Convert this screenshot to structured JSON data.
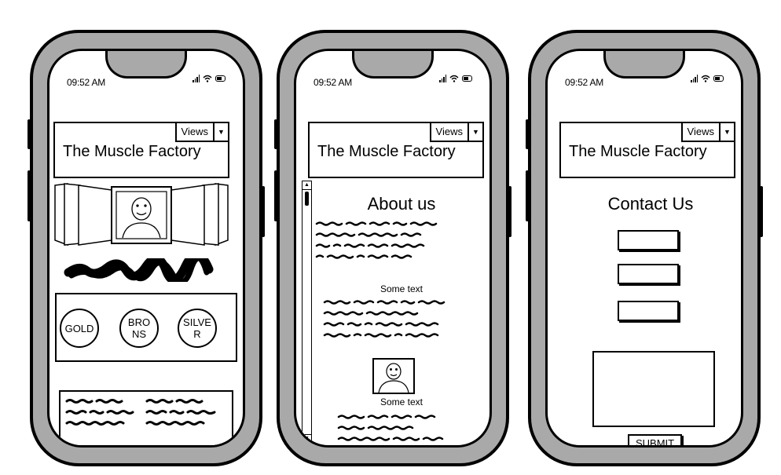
{
  "status_bar": {
    "time": "09:52 AM"
  },
  "header": {
    "title": "The Muscle Factory",
    "views_label": "Views"
  },
  "home": {
    "plans": [
      "GOLD",
      "BRONS",
      "SILVER"
    ],
    "plan_display": [
      "GOLD",
      "BRO\nNS",
      "SILVE\nR"
    ]
  },
  "about": {
    "heading": "About us",
    "subheading": "Some text",
    "caption": "Some text"
  },
  "contact": {
    "heading": "Contact Us",
    "submit_label": "SUBMIT"
  }
}
